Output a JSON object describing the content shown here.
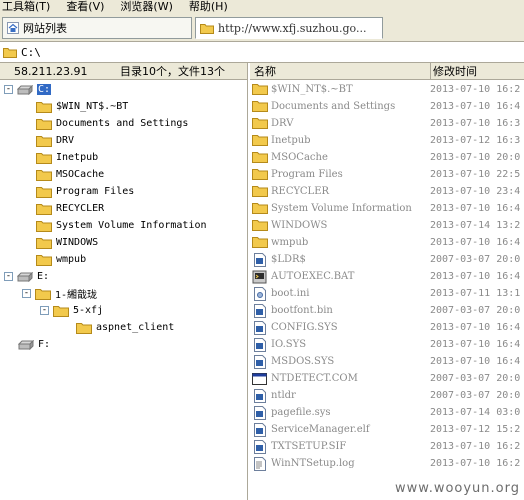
{
  "menu": [
    {
      "label": "工具箱(T)"
    },
    {
      "label": "查看(V)"
    },
    {
      "label": "浏览器(W)"
    },
    {
      "label": "帮助(H)"
    }
  ],
  "tabs": [
    {
      "label": "网站列表",
      "icon": "home-icon"
    },
    {
      "label": "http://www.xfj.suzhou.go...",
      "icon": "folder-icon"
    }
  ],
  "path": {
    "value": "C:\\"
  },
  "left_header": {
    "ip": "58.211.23.91",
    "summary": "目录10个，文件13个"
  },
  "tree": {
    "drive_c": {
      "label": "C:",
      "expander": "-"
    },
    "c_children": [
      {
        "label": "$WIN_NT$.~BT"
      },
      {
        "label": "Documents and Settings"
      },
      {
        "label": "DRV"
      },
      {
        "label": "Inetpub"
      },
      {
        "label": "MSOCache"
      },
      {
        "label": "Program Files"
      },
      {
        "label": "RECYCLER"
      },
      {
        "label": "System Volume Information"
      },
      {
        "label": "WINDOWS"
      },
      {
        "label": "wmpub"
      }
    ],
    "drive_e": {
      "label": "E:",
      "expander": "-"
    },
    "e_child": {
      "label": "1-緗戠珑",
      "expander": "-"
    },
    "e_grandchild": {
      "label": "5-xfj",
      "expander": "-"
    },
    "e_great": {
      "label": "aspnet_client"
    },
    "drive_f": {
      "label": "F:"
    }
  },
  "right_header": {
    "name": "名称",
    "time": "修改时间"
  },
  "files": [
    {
      "name": "$WIN_NT$.~BT",
      "time": "2013-07-10 16:2",
      "icon": "folder-icon"
    },
    {
      "name": "Documents and Settings",
      "time": "2013-07-10 16:4",
      "icon": "folder-icon"
    },
    {
      "name": "DRV",
      "time": "2013-07-10 16:3",
      "icon": "folder-icon"
    },
    {
      "name": "Inetpub",
      "time": "2013-07-12 16:3",
      "icon": "folder-icon"
    },
    {
      "name": "MSOCache",
      "time": "2013-07-10 20:0",
      "icon": "folder-icon"
    },
    {
      "name": "Program Files",
      "time": "2013-07-10 22:5",
      "icon": "folder-icon"
    },
    {
      "name": "RECYCLER",
      "time": "2013-07-10 23:4",
      "icon": "folder-icon"
    },
    {
      "name": "System Volume Information",
      "time": "2013-07-10 16:4",
      "icon": "folder-icon"
    },
    {
      "name": "WINDOWS",
      "time": "2013-07-14 13:2",
      "icon": "folder-icon"
    },
    {
      "name": "wmpub",
      "time": "2013-07-10 16:4",
      "icon": "folder-icon"
    },
    {
      "name": "$LDR$",
      "time": "2007-03-07 20:0",
      "icon": "file-icon"
    },
    {
      "name": "AUTOEXEC.BAT",
      "time": "2013-07-10 16:4",
      "icon": "batch-icon"
    },
    {
      "name": "boot.ini",
      "time": "2013-07-11 13:1",
      "icon": "settings-file-icon"
    },
    {
      "name": "bootfont.bin",
      "time": "2007-03-07 20:0",
      "icon": "file-icon"
    },
    {
      "name": "CONFIG.SYS",
      "time": "2013-07-10 16:4",
      "icon": "file-icon"
    },
    {
      "name": "IO.SYS",
      "time": "2013-07-10 16:4",
      "icon": "file-icon"
    },
    {
      "name": "MSDOS.SYS",
      "time": "2013-07-10 16:4",
      "icon": "file-icon"
    },
    {
      "name": "NTDETECT.COM",
      "time": "2007-03-07 20:0",
      "icon": "program-icon"
    },
    {
      "name": "ntldr",
      "time": "2007-03-07 20:0",
      "icon": "file-icon"
    },
    {
      "name": "pagefile.sys",
      "time": "2013-07-14 03:0",
      "icon": "file-icon"
    },
    {
      "name": "ServiceManager.elf",
      "time": "2013-07-12 15:2",
      "icon": "file-icon"
    },
    {
      "name": "TXTSETUP.SIF",
      "time": "2013-07-10 16:2",
      "icon": "file-icon"
    },
    {
      "name": "WinNTSetup.log",
      "time": "2013-07-10 16:2",
      "icon": "text-file-icon"
    }
  ],
  "watermark": "www.wooyun.org",
  "colors": {
    "folder": "#f2c94c",
    "selection": "#316ac5",
    "chrome": "#ece9d8"
  }
}
